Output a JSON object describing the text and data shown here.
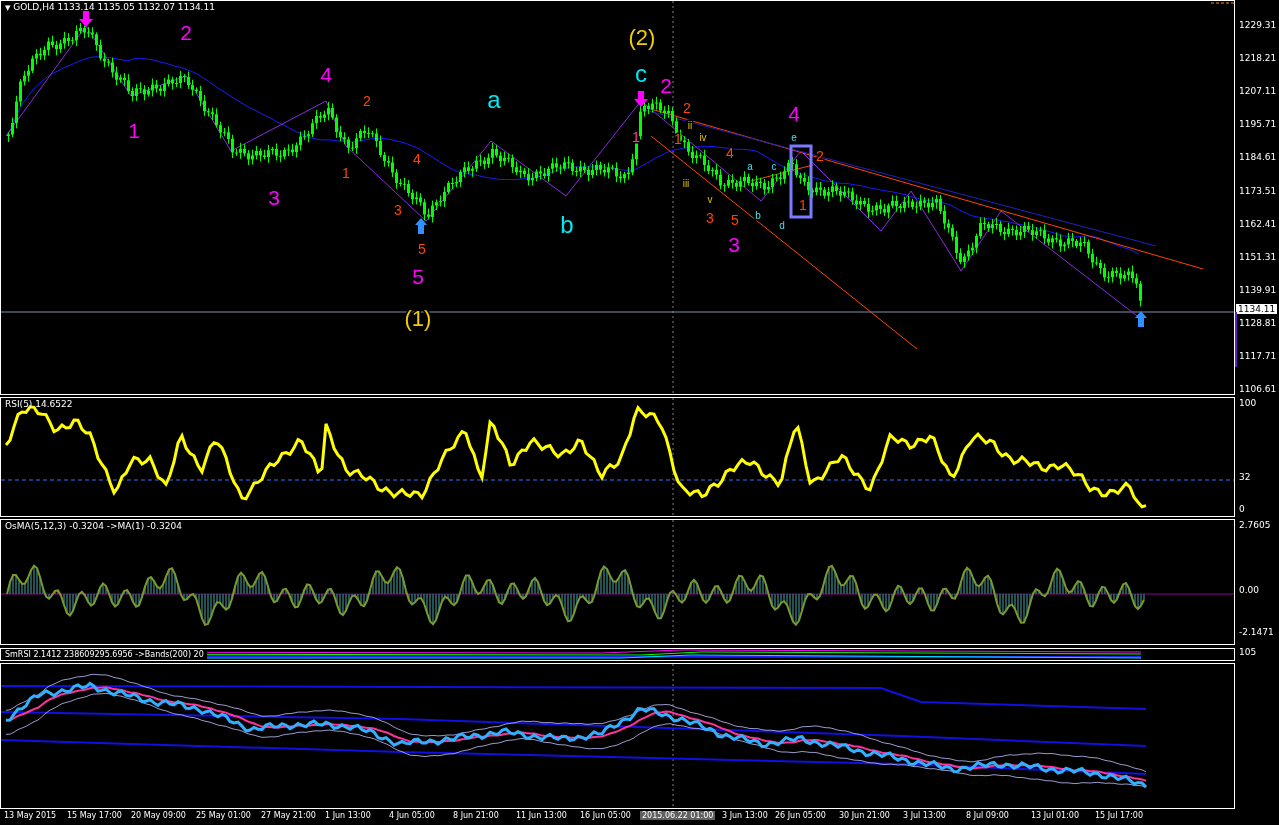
{
  "chart": {
    "menu_glyph": "▼",
    "header": "GOLD,H4  1133.14 1135.05 1132.07 1134.11",
    "price_axis": [
      "1229.31",
      "1218.21",
      "1207.11",
      "1195.71",
      "1184.61",
      "1173.51",
      "1162.41",
      "1151.31",
      "1139.91",
      "1128.81",
      "1117.71",
      "1106.61"
    ],
    "current_price": "1134.11",
    "wave_labels": [
      {
        "text": "2",
        "kind": "primary"
      },
      {
        "text": "1",
        "kind": "primary"
      },
      {
        "text": "4",
        "kind": "primary"
      },
      {
        "text": "3",
        "kind": "primary"
      },
      {
        "text": "2",
        "kind": "minute"
      },
      {
        "text": "1",
        "kind": "minute"
      },
      {
        "text": "4",
        "kind": "minute"
      },
      {
        "text": "3",
        "kind": "minute"
      },
      {
        "text": "5",
        "kind": "minute"
      },
      {
        "text": "5",
        "kind": "primary"
      },
      {
        "text": "(1)",
        "kind": "intermediate"
      },
      {
        "text": "a",
        "kind": "minor"
      },
      {
        "text": "b",
        "kind": "minor"
      },
      {
        "text": "(2)",
        "kind": "intermediate"
      },
      {
        "text": "c",
        "kind": "minor"
      },
      {
        "text": "2",
        "kind": "primary"
      },
      {
        "text": "1",
        "kind": "secondary"
      },
      {
        "text": "2",
        "kind": "minute"
      },
      {
        "text": "1",
        "kind": "minute"
      },
      {
        "text": "ii",
        "kind": "subminuette"
      },
      {
        "text": "iv",
        "kind": "subminuette"
      },
      {
        "text": "iii",
        "kind": "subminuette"
      },
      {
        "text": "v",
        "kind": "subminuette"
      },
      {
        "text": "4",
        "kind": "minute"
      },
      {
        "text": "3",
        "kind": "minute"
      },
      {
        "text": "5",
        "kind": "minute"
      },
      {
        "text": "3",
        "kind": "primary"
      },
      {
        "text": "a",
        "kind": "minuette"
      },
      {
        "text": "c",
        "kind": "minuette"
      },
      {
        "text": "b",
        "kind": "minuette"
      },
      {
        "text": "d",
        "kind": "minuette"
      },
      {
        "text": "e",
        "kind": "minuette"
      },
      {
        "text": "4",
        "kind": "primary"
      },
      {
        "text": "2",
        "kind": "minute"
      },
      {
        "text": "1",
        "kind": "minute"
      }
    ]
  },
  "rsi_pane": {
    "title": "RSI(5) 14.6522",
    "axis": [
      "100",
      "32",
      "0"
    ]
  },
  "osma_pane": {
    "title": "OsMA(5,12,3) -0.3204  ->MA(1) -0.3204",
    "axis": [
      "2.7605",
      "0.00",
      "-2.1471"
    ]
  },
  "smrsi_strip": {
    "title": "SmRSI 2.1412 238609295.6956 ->Bands(200) 20",
    "axis": [
      "105"
    ]
  },
  "time_axis": [
    {
      "label": "13 May 2015",
      "selected": false
    },
    {
      "label": "15 May 17:00",
      "selected": false
    },
    {
      "label": "20 May 09:00",
      "selected": false
    },
    {
      "label": "25 May 01:00",
      "selected": false
    },
    {
      "label": "27 May 21:00",
      "selected": false
    },
    {
      "label": "1 Jun 13:00",
      "selected": false
    },
    {
      "label": "4 Jun 05:00",
      "selected": false
    },
    {
      "label": "8 Jun 21:00",
      "selected": false
    },
    {
      "label": "11 Jun 13:00",
      "selected": false
    },
    {
      "label": "16 Jun 05:00",
      "selected": false
    },
    {
      "label": "2015.06.22 01:00",
      "selected": true
    },
    {
      "label": "3 Jun 13:00",
      "selected": false
    },
    {
      "label": "26 Jun 05:00",
      "selected": false
    },
    {
      "label": "30 Jun 21:00",
      "selected": false
    },
    {
      "label": "3 Jul 13:00",
      "selected": false
    },
    {
      "label": "8 Jul 09:00",
      "selected": false
    },
    {
      "label": "13 Jul 01:00",
      "selected": false
    },
    {
      "label": "15 Jul 17:00",
      "selected": false
    }
  ]
}
